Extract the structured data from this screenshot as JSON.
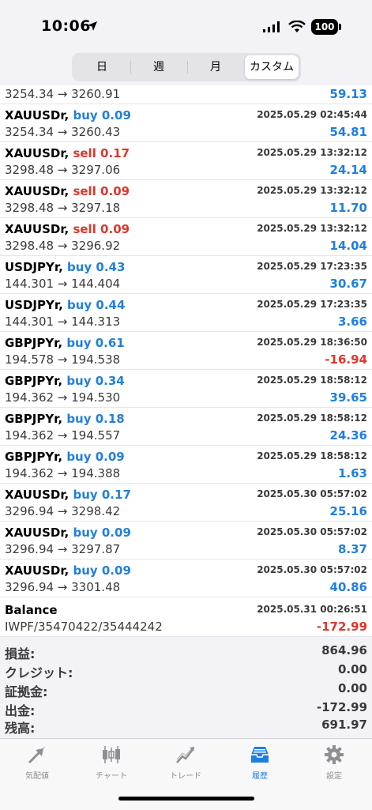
{
  "status_bar": {
    "time": "10:06",
    "battery": "100"
  },
  "segments": [
    "日",
    "週",
    "月",
    "カスタム"
  ],
  "selected_segment": "カスタム",
  "rows": [
    {
      "symbol": "",
      "side": "",
      "time": "",
      "prices": "3254.34 → 3260.91",
      "profit": "59.13"
    },
    {
      "symbol": "XAUUSDr,",
      "side": "buy 0.09",
      "time": "2025.05.29 02:45:44",
      "prices": "3254.34 → 3260.43",
      "profit": "54.81"
    },
    {
      "symbol": "XAUUSDr,",
      "side": "sell 0.17",
      "time": "2025.05.29 13:32:12",
      "prices": "3298.48 → 3297.06",
      "profit": "24.14"
    },
    {
      "symbol": "XAUUSDr,",
      "side": "sell 0.09",
      "time": "2025.05.29 13:32:12",
      "prices": "3298.48 → 3297.18",
      "profit": "11.70"
    },
    {
      "symbol": "XAUUSDr,",
      "side": "sell 0.09",
      "time": "2025.05.29 13:32:12",
      "prices": "3298.48 → 3296.92",
      "profit": "14.04"
    },
    {
      "symbol": "USDJPYr,",
      "side": "buy 0.43",
      "time": "2025.05.29 17:23:35",
      "prices": "144.301 → 144.404",
      "profit": "30.67"
    },
    {
      "symbol": "USDJPYr,",
      "side": "buy 0.44",
      "time": "2025.05.29 17:23:35",
      "prices": "144.301 → 144.313",
      "profit": "3.66"
    },
    {
      "symbol": "GBPJPYr,",
      "side": "buy 0.61",
      "time": "2025.05.29 18:36:50",
      "prices": "194.578 → 194.538",
      "profit": "-16.94"
    },
    {
      "symbol": "GBPJPYr,",
      "side": "buy 0.34",
      "time": "2025.05.29 18:58:12",
      "prices": "194.362 → 194.530",
      "profit": "39.65"
    },
    {
      "symbol": "GBPJPYr,",
      "side": "buy 0.18",
      "time": "2025.05.29 18:58:12",
      "prices": "194.362 → 194.557",
      "profit": "24.36"
    },
    {
      "symbol": "GBPJPYr,",
      "side": "buy 0.09",
      "time": "2025.05.29 18:58:12",
      "prices": "194.362 → 194.388",
      "profit": "1.63"
    },
    {
      "symbol": "XAUUSDr,",
      "side": "buy 0.17",
      "time": "2025.05.30 05:57:02",
      "prices": "3296.94 → 3298.42",
      "profit": "25.16"
    },
    {
      "symbol": "XAUUSDr,",
      "side": "buy 0.09",
      "time": "2025.05.30 05:57:02",
      "prices": "3296.94 → 3297.87",
      "profit": "8.37"
    },
    {
      "symbol": "XAUUSDr,",
      "side": "buy 0.09",
      "time": "2025.05.30 05:57:02",
      "prices": "3296.94 → 3301.48",
      "profit": "40.86"
    },
    {
      "symbol": "Balance",
      "side": "",
      "time": "2025.05.31 00:26:51",
      "prices": "IWPF/35470422/35444242",
      "profit": "-172.99"
    }
  ],
  "summary": [
    {
      "label": "損益:",
      "value": "864.96"
    },
    {
      "label": "クレジット:",
      "value": "0.00"
    },
    {
      "label": "証拠金:",
      "value": "0.00"
    },
    {
      "label": "出金:",
      "value": "-172.99"
    },
    {
      "label": "残高:",
      "value": "691.97"
    }
  ],
  "tabs": [
    {
      "label": "気配値",
      "icon": "quotes-icon"
    },
    {
      "label": "チャート",
      "icon": "chart-icon"
    },
    {
      "label": "トレード",
      "icon": "trade-icon"
    },
    {
      "label": "履歴",
      "icon": "history-icon"
    },
    {
      "label": "設定",
      "icon": "settings-icon"
    }
  ],
  "active_tab": "履歴",
  "colors": {
    "buy": "#1f7fe0",
    "sell": "#e0352b",
    "profit_positive": "#1f7fe0",
    "profit_negative": "#e0352b"
  }
}
